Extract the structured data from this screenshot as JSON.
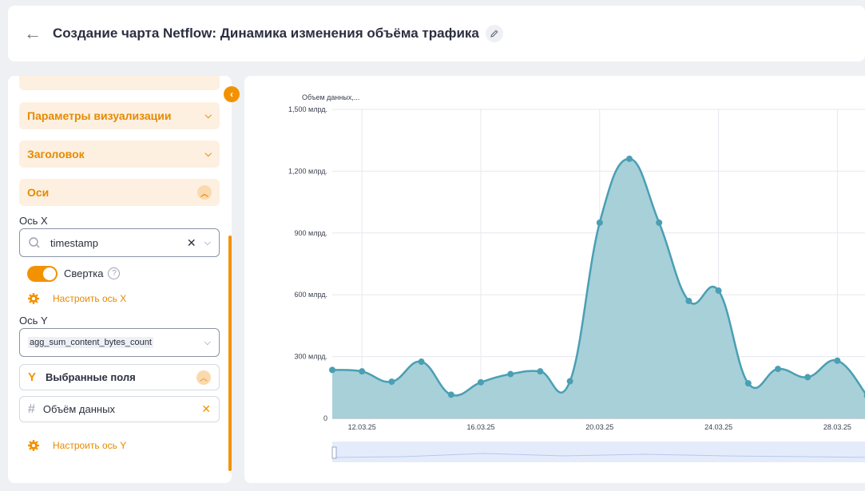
{
  "header": {
    "title": "Создание чарта Netflow: Динамика изменения объёма трафика"
  },
  "sidebar": {
    "sections": [
      {
        "label": "Параметры визуализации",
        "state": "collapsed"
      },
      {
        "label": "Заголовок",
        "state": "collapsed"
      },
      {
        "label": "Оси",
        "state": "expanded"
      }
    ],
    "x_axis": {
      "label": "Ось X",
      "value": "timestamp",
      "toggle_label": "Свертка",
      "toggle_on": true,
      "configure_label": "Настроить ось X"
    },
    "y_axis": {
      "label": "Ось Y",
      "value": "agg_sum_content_bytes_count",
      "selected_fields_label": "Выбранные поля",
      "field": "Объём данных",
      "configure_label": "Настроить ось Y"
    }
  },
  "chart_data": {
    "type": "area",
    "ylabel": "Объем данных,...",
    "ylim": [
      0,
      1500000000000
    ],
    "yticks": [
      "0",
      "300 млрд.",
      "600 млрд.",
      "900 млрд.",
      "1,200 млрд.",
      "1,500 млрд."
    ],
    "xticks": [
      "12.03.25",
      "16.03.25",
      "20.03.25",
      "24.03.25",
      "28.03.25"
    ],
    "x": [
      "11.03.25",
      "12.03.25",
      "13.03.25",
      "14.03.25",
      "15.03.25",
      "16.03.25",
      "17.03.25",
      "18.03.25",
      "19.03.25",
      "20.03.25",
      "21.03.25",
      "22.03.25",
      "23.03.25",
      "24.03.25",
      "25.03.25",
      "26.03.25",
      "27.03.25",
      "28.03.25",
      "29.03.25"
    ],
    "series": [
      {
        "values": [
          235,
          228,
          178,
          275,
          115,
          175,
          215,
          228,
          180,
          950,
          1260,
          950,
          570,
          620,
          170,
          240,
          200,
          280,
          110
        ]
      }
    ],
    "value_unit_multiplier": 1000000000,
    "color": "#4a9fb3",
    "fill_color": "#a7d0d9",
    "grid": true
  }
}
